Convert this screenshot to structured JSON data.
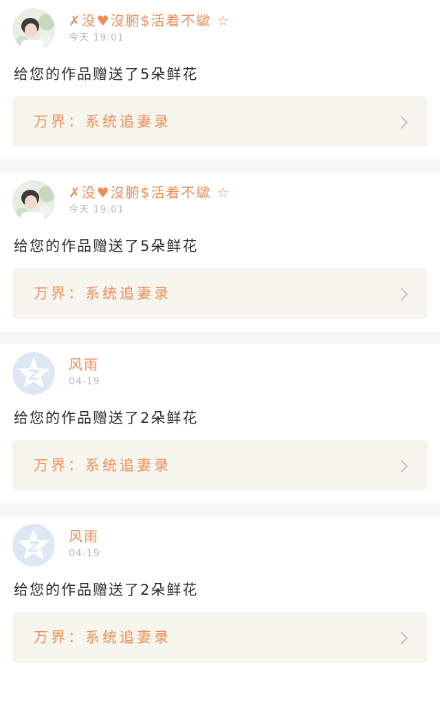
{
  "notifications": [
    {
      "username": "✗没♥沒腑$活着不㱍 ☆",
      "avatar_icon": "profile-photo-woman-with-flowers",
      "timestamp": "今天 19:01",
      "message": "给您的作品赠送了5朵鲜花",
      "work_title": "万界：系统追妻录"
    },
    {
      "username": "✗没♥沒腑$活着不㱍 ☆",
      "avatar_icon": "profile-photo-woman-with-flowers",
      "timestamp": "今天 19:01",
      "message": "给您的作品赠送了5朵鲜花",
      "work_title": "万界：系统追妻录"
    },
    {
      "username": "风雨",
      "avatar_icon": "default-avatar-z-icon",
      "timestamp": "04-19",
      "message": "给您的作品赠送了2朵鲜花",
      "work_title": "万界：系统追妻录"
    },
    {
      "username": "风雨",
      "avatar_icon": "default-avatar-z-icon",
      "timestamp": "04-19",
      "message": "给您的作品赠送了2朵鲜花",
      "work_title": "万界：系统追妻录"
    }
  ],
  "colors": {
    "accent": "#ee8c55",
    "timestamp": "#b8b8b8",
    "link_bg": "#f6f6ef",
    "separator": "#f7f5f5",
    "default_avatar_bg": "#dde8f4"
  }
}
